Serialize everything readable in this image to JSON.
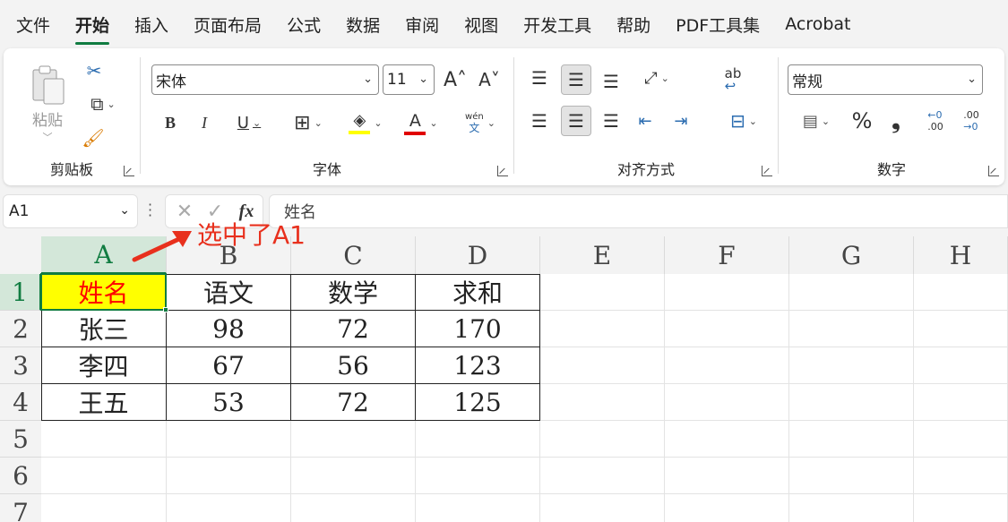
{
  "menu": [
    "文件",
    "开始",
    "插入",
    "页面布局",
    "公式",
    "数据",
    "审阅",
    "视图",
    "开发工具",
    "帮助",
    "PDF工具集",
    "Acrobat"
  ],
  "active_menu_index": 1,
  "ribbon": {
    "clipboard": {
      "label": "剪贴板",
      "paste_label": "粘贴"
    },
    "font": {
      "label": "字体",
      "font_name": "宋体",
      "font_size": "11",
      "phonetic_top": "wén",
      "phonetic_bottom": "文"
    },
    "alignment": {
      "label": "对齐方式"
    },
    "number": {
      "label": "数字",
      "format": "常规",
      "percent": "%",
      "comma": "❟",
      "dec_inc_top": "←0",
      "dec_inc_bottom": ".00",
      "dec_dec_top": ".00",
      "dec_dec_bottom": "→0"
    }
  },
  "formula_bar": {
    "name_box": "A1",
    "fx": "fx",
    "content": "姓名"
  },
  "annotation": "选中了A1",
  "columns": [
    "A",
    "B",
    "C",
    "D",
    "E",
    "F",
    "G",
    "H"
  ],
  "rows": [
    "1",
    "2",
    "3",
    "4",
    "5",
    "6",
    "7"
  ],
  "table": [
    [
      "姓名",
      "语文",
      "数学",
      "求和"
    ],
    [
      "张三",
      "98",
      "72",
      "170"
    ],
    [
      "李四",
      "67",
      "56",
      "123"
    ],
    [
      "王五",
      "53",
      "72",
      "125"
    ]
  ],
  "colors": {
    "accent": "#107c41",
    "annotation": "#e8301d",
    "a1_fill": "#ffff00",
    "a1_text": "#ff0000"
  }
}
